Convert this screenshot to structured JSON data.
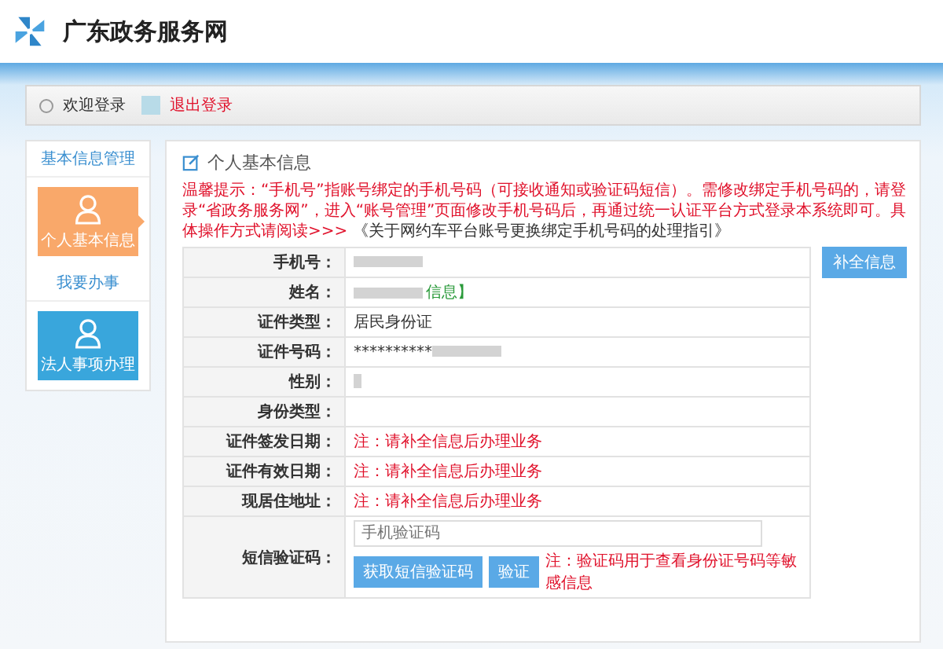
{
  "header": {
    "site_title": "广东政务服务网"
  },
  "user_bar": {
    "greeting": "欢迎登录",
    "logout": "退出登录"
  },
  "sidebar": {
    "sections": [
      {
        "title": "基本信息管理",
        "tiles": [
          {
            "label": "个人基本信息",
            "selected": true
          }
        ]
      },
      {
        "title": "我要办事",
        "tiles": [
          {
            "label": "法人事项办理",
            "selected": false
          }
        ]
      }
    ]
  },
  "panel": {
    "title": "个人基本信息",
    "notice": "温馨提示：“手机号”指账号绑定的手机号码（可接收通知或验证码短信）。需修改绑定手机号码的，请登录“省政务服务网”，进入“账号管理”页面修改手机号码后，再通过统一认证平台方式登录本系统即可。具体操作方式请阅读>>>",
    "notice_link": "《关于网约车平台账号更换绑定手机号码的处理指引》",
    "side_button": "补全信息",
    "rows": [
      {
        "label": "手机号：",
        "value": [
          {
            "kind": "blur"
          }
        ]
      },
      {
        "label": "姓名：",
        "value": [
          {
            "kind": "blur"
          },
          {
            "kind": "link",
            "text": "信息】"
          }
        ]
      },
      {
        "label": "证件类型：",
        "value": [
          {
            "kind": "text",
            "text": "居民身份证"
          }
        ]
      },
      {
        "label": "证件号码：",
        "value": [
          {
            "kind": "text",
            "text": "**********"
          },
          {
            "kind": "blur"
          }
        ]
      },
      {
        "label": "性别：",
        "value": [
          {
            "kind": "blur_small"
          }
        ]
      },
      {
        "label": "身份类型：",
        "value": []
      },
      {
        "label": "证件签发日期：",
        "value": [
          {
            "kind": "note",
            "text": "注：请补全信息后办理业务"
          }
        ]
      },
      {
        "label": "证件有效日期：",
        "value": [
          {
            "kind": "note",
            "text": "注：请补全信息后办理业务"
          }
        ]
      },
      {
        "label": "现居住地址：",
        "value": [
          {
            "kind": "note",
            "text": "注：请补全信息后办理业务"
          }
        ]
      }
    ],
    "sms": {
      "label": "短信验证码：",
      "placeholder": "手机验证码",
      "get_code_button": "获取短信验证码",
      "verify_button": "验证",
      "note": "注：验证码用于查看身份证号码等敏感信息"
    }
  }
}
